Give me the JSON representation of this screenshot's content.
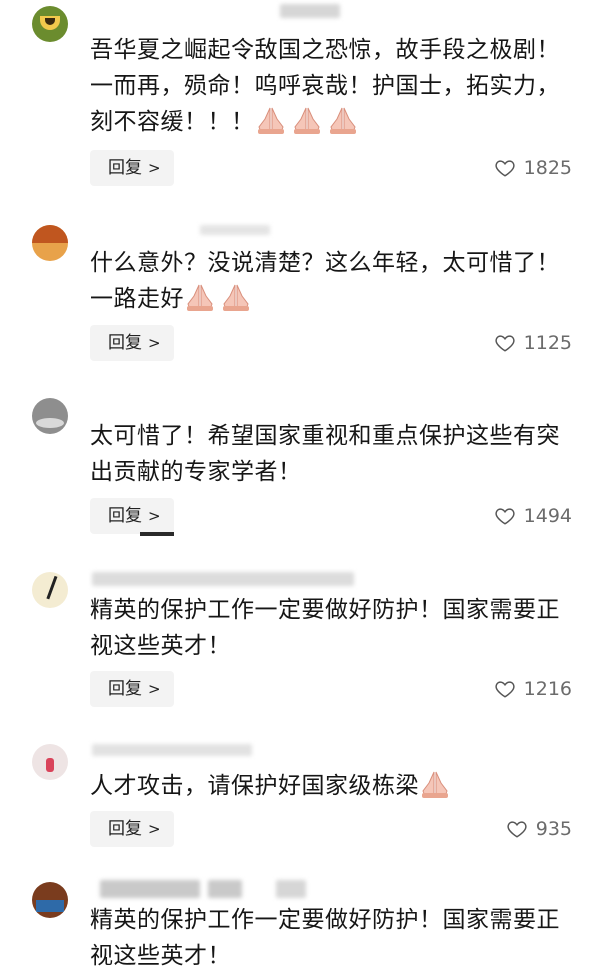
{
  "comments": [
    {
      "meta": "",
      "text": "吾华夏之崛起令敌国之恐惊，故手段之极剧！一而再，殒命！呜呼哀哉！护国士，拓实力，刻不容缓！！！",
      "hands": 3,
      "reply_label": "回复",
      "likes": "1825"
    },
    {
      "meta": "",
      "text": "什么意外？没说清楚？这么年轻，太可惜了！一路走好",
      "hands": 2,
      "reply_label": "回复",
      "likes": "1125"
    },
    {
      "meta": "",
      "text": "太可惜了！希望国家重视和重点保护这些有突出贡献的专家学者！",
      "hands": 0,
      "reply_label": "回复",
      "likes": "1494"
    },
    {
      "meta": "",
      "text": "精英的保护工作一定要做好防护！国家需要正视这些英才！",
      "hands": 0,
      "reply_label": "回复",
      "likes": "1216"
    },
    {
      "meta": "",
      "text": "人才攻击，请保护好国家级栋梁",
      "hands": 1,
      "reply_label": "回复",
      "likes": "935"
    },
    {
      "meta": "",
      "text": "精英的保护工作一定要做好防护！国家需要正视这些英才！",
      "hands": 0,
      "reply_label": "",
      "likes": ""
    }
  ],
  "icons": {
    "reply_chevron": "chevron-right-icon",
    "like": "heart-outline-icon",
    "emoji": "folded-hands-emoji"
  },
  "colors": {
    "text": "#161616",
    "secondary": "#6b6b6b",
    "reply_bg": "#f3f3f3",
    "hand": "#f5c6b8"
  }
}
